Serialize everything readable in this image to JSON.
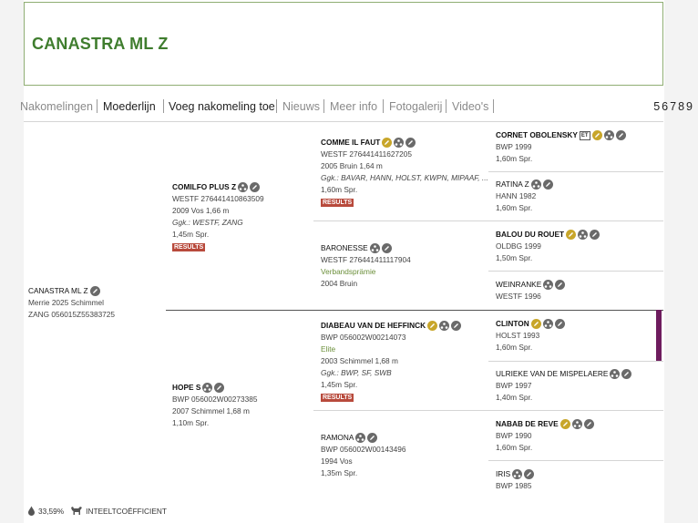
{
  "title": "CANASTRA ML Z",
  "nav": {
    "tabs": [
      "Nakomelingen",
      "Moederlijn",
      "Voeg nakomeling toe",
      "Nieuws",
      "Meer info",
      "Fotogalerij",
      "Video's"
    ],
    "pages": "56789"
  },
  "subject": {
    "name": "CANASTRA ML Z",
    "line1": "Merrie 2025 Schimmel",
    "line2": "ZANG 056015Z55383725"
  },
  "sire": {
    "name": "COMILFO PLUS Z",
    "reg": "WESTF 276441410863509",
    "line": "2009 Vos 1,66 m",
    "gk": "Ggk.: WESTF, ZANG",
    "spr": "1,45m Spr.",
    "results": "RESULTS"
  },
  "dam": {
    "name": "HOPE S",
    "reg": "BWP 056002W00273385",
    "line": "2007 Schimmel 1,68 m",
    "spr": "1,10m Spr."
  },
  "ss": {
    "name": "COMME IL FAUT",
    "reg": "WESTF 276441411627205",
    "line": "2005 Bruin 1,64 m",
    "gk": "Ggk.: BAVAR, HANN, HOLST, KWPN, MIPAAF, ...",
    "spr": "1,60m Spr.",
    "results": "RESULTS"
  },
  "sd": {
    "name": "BARONESSE",
    "reg": "WESTF 276441411117904",
    "rating": "Verbandsprämie",
    "line": "2004 Bruin"
  },
  "ds": {
    "name": "DIABEAU VAN DE HEFFINCK",
    "reg": "BWP 056002W00214073",
    "rating": "Elite",
    "line": "2003 Schimmel 1,68 m",
    "gk": "Ggk.: BWP, SF, SWB",
    "spr": "1,45m Spr.",
    "results": "RESULTS"
  },
  "dd": {
    "name": "RAMONA",
    "reg": "BWP 056002W00143496",
    "line": "1994 Vos",
    "spr": "1,35m Spr."
  },
  "sss": {
    "name": "CORNET OBOLENSKY",
    "badge": "ET",
    "reg": "BWP 1999",
    "spr": "1,60m Spr."
  },
  "ssd": {
    "name": "RATINA Z",
    "reg": "HANN 1982",
    "spr": "1,60m Spr."
  },
  "sds": {
    "name": "BALOU DU ROUET",
    "reg": "OLDBG 1999",
    "spr": "1,50m Spr."
  },
  "sdd": {
    "name": "WEINRANKE",
    "reg": "WESTF 1996"
  },
  "dss": {
    "name": "CLINTON",
    "reg": "HOLST 1993",
    "spr": "1,60m Spr."
  },
  "dsd": {
    "name": "ULRIEKE VAN DE MISPELAERE",
    "reg": "BWP 1997",
    "spr": "1,40m Spr."
  },
  "dds": {
    "name": "NABAB DE REVE",
    "reg": "BWP 1990",
    "spr": "1,60m Spr."
  },
  "ddd": {
    "name": "IRIS",
    "reg": "BWP 1985"
  },
  "footer": {
    "percent": "33,59%",
    "label": "INTEELTCOËFFICIENT"
  },
  "colors": {
    "title_green": "#3f7d2e",
    "results_red": "#b84a3c",
    "gold_icon": "#c8a62a",
    "marker_purple": "#6e1c5e"
  },
  "icons": [
    "pencil-icon",
    "family-tree-icon",
    "horse-icon",
    "drop-icon"
  ]
}
